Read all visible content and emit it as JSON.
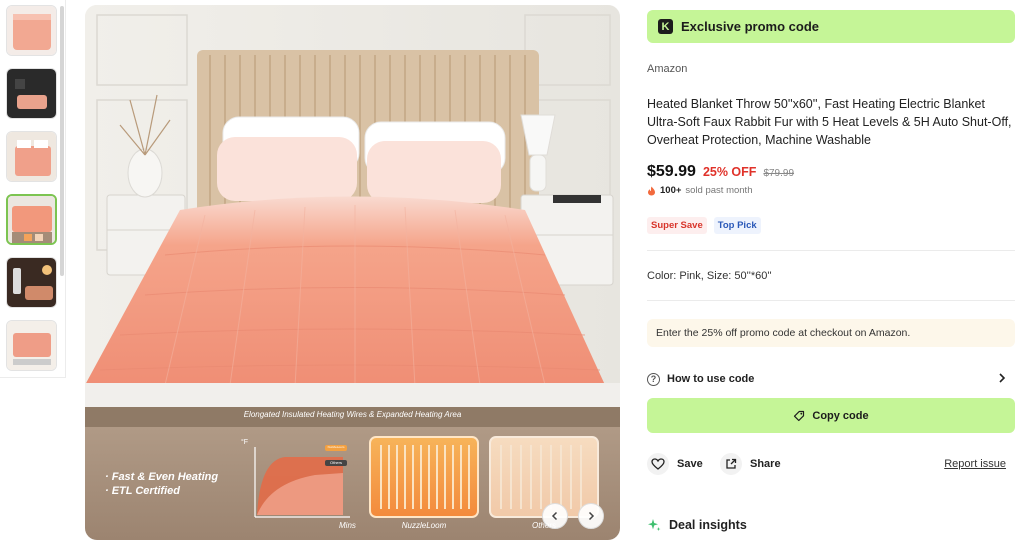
{
  "thumbnails": [
    {
      "name": "thumb-1",
      "active": false
    },
    {
      "name": "thumb-2",
      "active": false
    },
    {
      "name": "thumb-3",
      "active": false
    },
    {
      "name": "thumb-4",
      "active": true
    },
    {
      "name": "thumb-5",
      "active": false
    },
    {
      "name": "thumb-6",
      "active": false
    }
  ],
  "main_image": {
    "banner_text": "Elongated Insulated Heating Wires & Expanded Heating Area",
    "features": [
      "· Fast & Even Heating",
      "· ETL Certified"
    ],
    "chart": {
      "y_unit": "°F",
      "x_label": "Mins",
      "badge_top": "NuzzleLoom",
      "badge_other": "Others"
    },
    "panel_labels": [
      "NuzzleLoom",
      "Others"
    ]
  },
  "promo": {
    "icon": "K",
    "title": "Exclusive promo code"
  },
  "product": {
    "store": "Amazon",
    "title": "Heated Blanket Throw 50''x60'', Fast Heating Electric Blanket Ultra-Soft Faux Rabbit Fur with 5 Heat Levels & 5H Auto Shut-Off, Overheat Protection, Machine Washable",
    "price": "$59.99",
    "discount": "25% OFF",
    "old_price": "$79.99",
    "sold_count": "100+",
    "sold_text": "sold past month",
    "tags": [
      "Super Save",
      "Top Pick"
    ],
    "variant": "Color: Pink, Size: 50''*60''"
  },
  "promo_note": "Enter the 25% off promo code at checkout on Amazon.",
  "how_to": "How to use code",
  "copy_code": "Copy code",
  "actions": {
    "save": "Save",
    "share": "Share",
    "report": "Report issue"
  },
  "deal_insights": "Deal insights",
  "colors": {
    "accent_green": "#c5f597",
    "discount_red": "#e0322a",
    "blanket_pink": "#f08f77"
  }
}
